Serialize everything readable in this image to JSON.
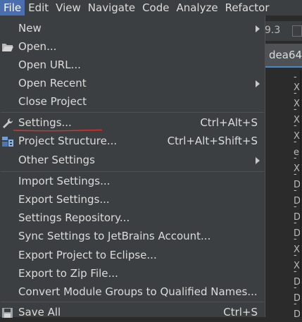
{
  "menubar": [
    "File",
    "Edit",
    "View",
    "Navigate",
    "Code",
    "Analyze",
    "Refactor"
  ],
  "background": {
    "breadcrumb": "9.3",
    "tab": "dea64.",
    "line_marks": [
      "-X",
      "-X",
      "-X",
      "-X",
      "-e",
      "-X",
      "-D",
      "-D",
      "-D",
      "-D",
      "-X",
      "-X",
      "-D",
      "-D",
      "-D",
      "-D",
      "-D"
    ]
  },
  "menu": {
    "items": [
      {
        "label": "New",
        "shortcut": "",
        "submenu": true
      },
      {
        "label": "Open...",
        "shortcut": "",
        "icon": "folder-icon"
      },
      {
        "label": "Open URL...",
        "shortcut": ""
      },
      {
        "label": "Open Recent",
        "shortcut": "",
        "submenu": true
      },
      {
        "label": "Close Project",
        "shortcut": ""
      },
      {
        "label": "Settings...",
        "shortcut": "Ctrl+Alt+S",
        "icon": "wrench-icon"
      },
      {
        "label": "Project Structure...",
        "shortcut": "Ctrl+Alt+Shift+S",
        "icon": "project-structure-icon"
      },
      {
        "label": "Other Settings",
        "shortcut": "",
        "submenu": true
      },
      {
        "label": "Import Settings...",
        "shortcut": ""
      },
      {
        "label": "Export Settings...",
        "shortcut": ""
      },
      {
        "label": "Settings Repository...",
        "shortcut": ""
      },
      {
        "label": "Sync Settings to JetBrains Account...",
        "shortcut": ""
      },
      {
        "label": "Export Project to Eclipse...",
        "shortcut": ""
      },
      {
        "label": "Export to Zip File...",
        "shortcut": ""
      },
      {
        "label": "Convert Module Groups to Qualified Names...",
        "shortcut": ""
      },
      {
        "label": "Save All",
        "shortcut": "Ctrl+S",
        "icon": "save-icon"
      }
    ]
  },
  "colors": {
    "accent": "#4b6eaf",
    "annotation": "#e0302b"
  }
}
